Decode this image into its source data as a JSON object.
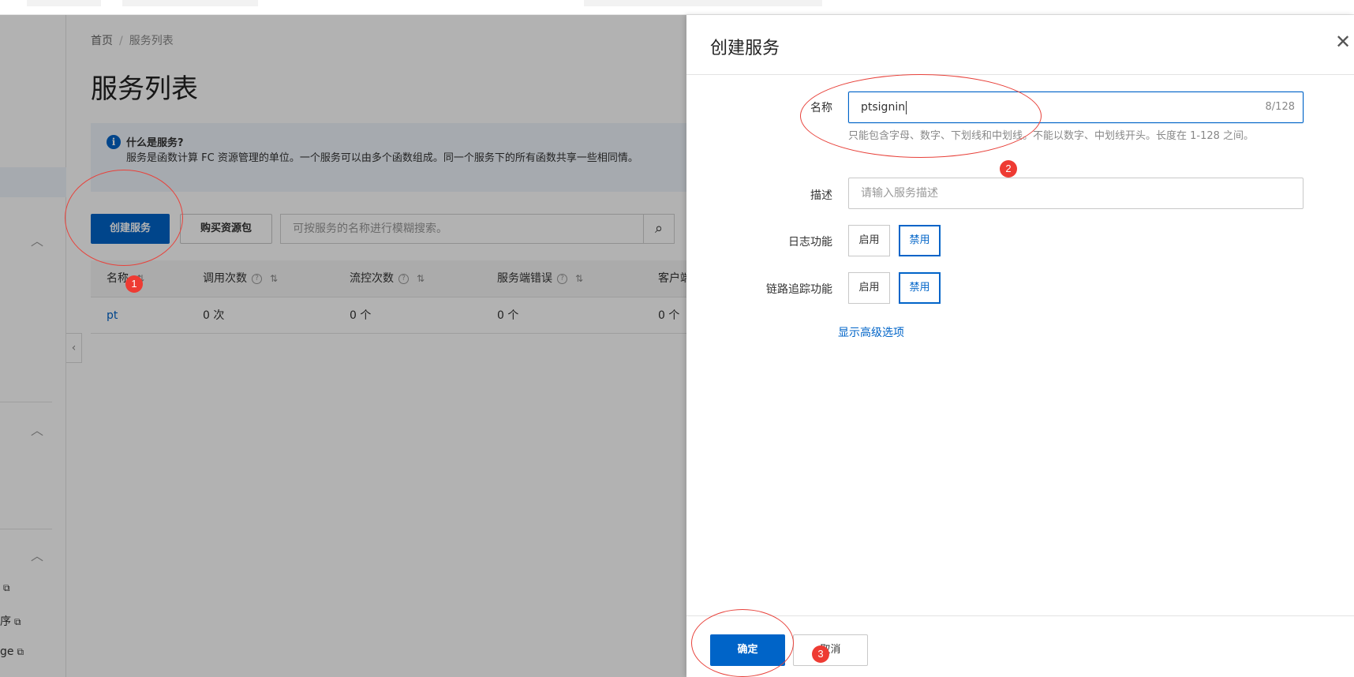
{
  "breadcrumb": {
    "home": "首页",
    "current": "服务列表"
  },
  "page": {
    "title": "服务列表"
  },
  "info": {
    "title": "什么是服务?",
    "text": "服务是函数计算 FC 资源管理的单位。一个服务可以由多个函数组成。同一个服务下的所有函数共享一些相同情。"
  },
  "toolbar": {
    "create_label": "创建服务",
    "buy_label": "购买资源包",
    "search_placeholder": "可按服务的名称进行模糊搜索。"
  },
  "table": {
    "headers": [
      "名称",
      "调用次数",
      "流控次数",
      "服务端错误",
      "客户端"
    ],
    "rows": [
      [
        "pt",
        "0 次",
        "0 个",
        "0 个",
        "0 个"
      ]
    ]
  },
  "sidebar": {
    "ext_links": [
      "",
      "序",
      "ge"
    ]
  },
  "drawer": {
    "title": "创建服务",
    "name_label": "名称",
    "name_value": "ptsignin",
    "name_counter": "8/128",
    "name_help": "只能包含字母、数字、下划线和中划线。不能以数字、中划线开头。长度在 1-128 之间。",
    "desc_label": "描述",
    "desc_placeholder": "请输入服务描述",
    "log_label": "日志功能",
    "trace_label": "链路追踪功能",
    "enable_label": "启用",
    "disable_label": "禁用",
    "advanced_link": "显示高级选项",
    "confirm_label": "确定",
    "cancel_label": "取消"
  },
  "annotations": [
    "1",
    "2",
    "3"
  ],
  "colors": {
    "primary": "#0064c8",
    "annotation": "#ee3b33"
  }
}
